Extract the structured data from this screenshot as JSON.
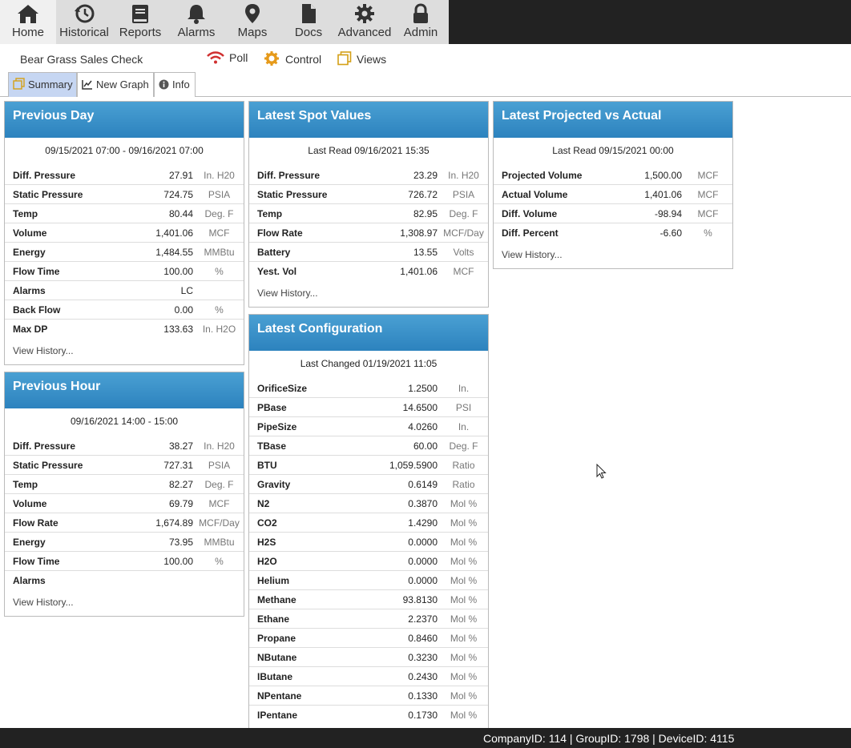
{
  "nav": [
    {
      "label": "Home",
      "icon": "home-icon",
      "active": true
    },
    {
      "label": "Historical",
      "icon": "history-icon"
    },
    {
      "label": "Reports",
      "icon": "book-icon"
    },
    {
      "label": "Alarms",
      "icon": "bell-icon"
    },
    {
      "label": "Maps",
      "icon": "map-marker-icon"
    },
    {
      "label": "Docs",
      "icon": "document-icon"
    },
    {
      "label": "Advanced",
      "icon": "gear-icon"
    },
    {
      "label": "Admin",
      "icon": "lock-icon"
    }
  ],
  "subbar": {
    "device_name": "Bear Grass Sales Check",
    "poll": "Poll",
    "control": "Control",
    "views": "Views"
  },
  "tabs": {
    "summary": "Summary",
    "new_graph": "New Graph",
    "info": "Info"
  },
  "previous_day": {
    "title": "Previous Day",
    "range": "09/15/2021 07:00 - 09/16/2021 07:00",
    "rows": [
      {
        "label": "Diff. Pressure",
        "value": "27.91",
        "unit": "In. H20"
      },
      {
        "label": "Static Pressure",
        "value": "724.75",
        "unit": "PSIA"
      },
      {
        "label": "Temp",
        "value": "80.44",
        "unit": "Deg. F"
      },
      {
        "label": "Volume",
        "value": "1,401.06",
        "unit": "MCF"
      },
      {
        "label": "Energy",
        "value": "1,484.55",
        "unit": "MMBtu"
      },
      {
        "label": "Flow Time",
        "value": "100.00",
        "unit": "%"
      },
      {
        "label": "Alarms",
        "value": "LC",
        "unit": ""
      },
      {
        "label": "Back Flow",
        "value": "0.00",
        "unit": "%"
      },
      {
        "label": "Max DP",
        "value": "133.63",
        "unit": "In. H2O"
      }
    ],
    "view_history": "View History..."
  },
  "previous_hour": {
    "title": "Previous Hour",
    "range": "09/16/2021 14:00 - 15:00",
    "rows": [
      {
        "label": "Diff. Pressure",
        "value": "38.27",
        "unit": "In. H20"
      },
      {
        "label": "Static Pressure",
        "value": "727.31",
        "unit": "PSIA"
      },
      {
        "label": "Temp",
        "value": "82.27",
        "unit": "Deg. F"
      },
      {
        "label": "Volume",
        "value": "69.79",
        "unit": "MCF"
      },
      {
        "label": "Flow Rate",
        "value": "1,674.89",
        "unit": "MCF/Day"
      },
      {
        "label": "Energy",
        "value": "73.95",
        "unit": "MMBtu"
      },
      {
        "label": "Flow Time",
        "value": "100.00",
        "unit": "%"
      },
      {
        "label": "Alarms",
        "value": "",
        "unit": ""
      }
    ],
    "view_history": "View History..."
  },
  "spot_values": {
    "title": "Latest Spot Values",
    "last_read": "Last Read 09/16/2021 15:35",
    "rows": [
      {
        "label": "Diff. Pressure",
        "value": "23.29",
        "unit": "In. H20"
      },
      {
        "label": "Static Pressure",
        "value": "726.72",
        "unit": "PSIA"
      },
      {
        "label": "Temp",
        "value": "82.95",
        "unit": "Deg. F"
      },
      {
        "label": "Flow Rate",
        "value": "1,308.97",
        "unit": "MCF/Day"
      },
      {
        "label": "Battery",
        "value": "13.55",
        "unit": "Volts"
      },
      {
        "label": "Yest. Vol",
        "value": "1,401.06",
        "unit": "MCF"
      }
    ],
    "view_history": "View History..."
  },
  "configuration": {
    "title": "Latest Configuration",
    "last_changed": "Last Changed 01/19/2021 11:05",
    "rows": [
      {
        "label": "OrificeSize",
        "value": "1.2500",
        "unit": "In."
      },
      {
        "label": "PBase",
        "value": "14.6500",
        "unit": "PSI"
      },
      {
        "label": "PipeSize",
        "value": "4.0260",
        "unit": "In."
      },
      {
        "label": "TBase",
        "value": "60.00",
        "unit": "Deg. F"
      },
      {
        "label": "BTU",
        "value": "1,059.5900",
        "unit": "Ratio"
      },
      {
        "label": "Gravity",
        "value": "0.6149",
        "unit": "Ratio"
      },
      {
        "label": "N2",
        "value": "0.3870",
        "unit": "Mol %"
      },
      {
        "label": "CO2",
        "value": "1.4290",
        "unit": "Mol %"
      },
      {
        "label": "H2S",
        "value": "0.0000",
        "unit": "Mol %"
      },
      {
        "label": "H2O",
        "value": "0.0000",
        "unit": "Mol %"
      },
      {
        "label": "Helium",
        "value": "0.0000",
        "unit": "Mol %"
      },
      {
        "label": "Methane",
        "value": "93.8130",
        "unit": "Mol %"
      },
      {
        "label": "Ethane",
        "value": "2.2370",
        "unit": "Mol %"
      },
      {
        "label": "Propane",
        "value": "0.8460",
        "unit": "Mol %"
      },
      {
        "label": "NButane",
        "value": "0.3230",
        "unit": "Mol %"
      },
      {
        "label": "IButane",
        "value": "0.2430",
        "unit": "Mol %"
      },
      {
        "label": "NPentane",
        "value": "0.1330",
        "unit": "Mol %"
      },
      {
        "label": "IPentane",
        "value": "0.1730",
        "unit": "Mol %"
      }
    ]
  },
  "projected": {
    "title": "Latest Projected vs Actual",
    "last_read": "Last Read 09/15/2021 00:00",
    "rows": [
      {
        "label": "Projected Volume",
        "value": "1,500.00",
        "unit": "MCF"
      },
      {
        "label": "Actual Volume",
        "value": "1,401.06",
        "unit": "MCF"
      },
      {
        "label": "Diff. Volume",
        "value": "-98.94",
        "unit": "MCF"
      },
      {
        "label": "Diff. Percent",
        "value": "-6.60",
        "unit": "%"
      }
    ],
    "view_history": "View History..."
  },
  "footer": "CompanyID: 114 | GroupID: 1798 | DeviceID: 4115",
  "colors": {
    "header_gradient_top": "#4aa0d3",
    "header_gradient_bottom": "#2c82be",
    "topbar": "#222222",
    "active_tab": "#c6d6f2",
    "wifi_icon": "#d03030",
    "control_icon": "#e69a1a",
    "views_icon": "#d4a017"
  }
}
